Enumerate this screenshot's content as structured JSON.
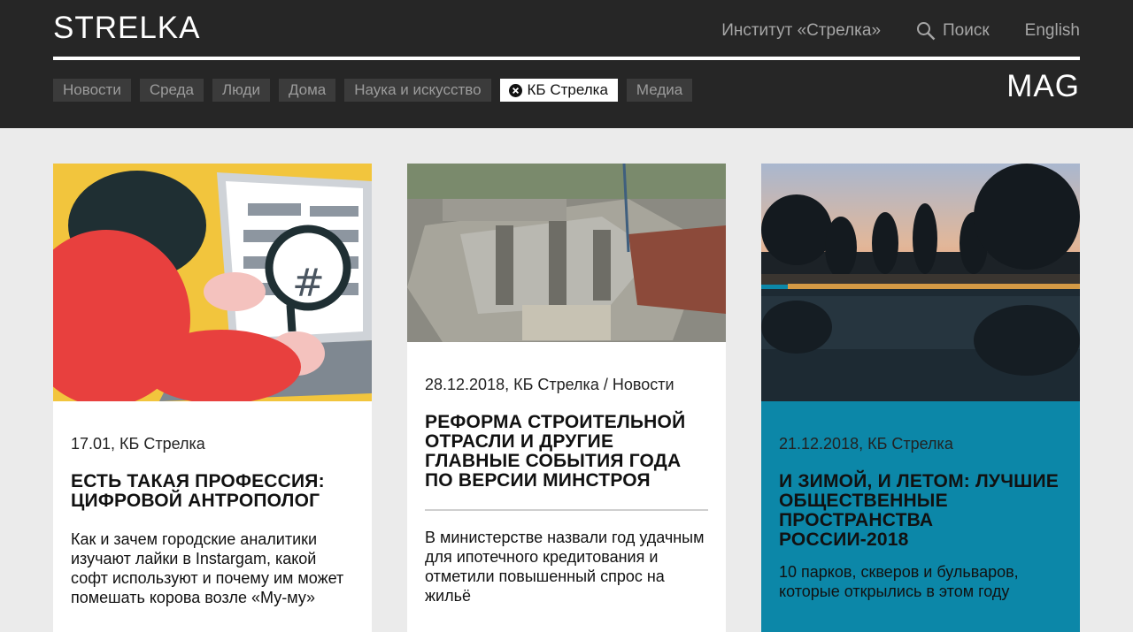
{
  "header": {
    "logo": "STRELKA",
    "links": {
      "institute": "Институт «Стрелка»",
      "search": "Поиск",
      "language": "English"
    },
    "mag": "MAG"
  },
  "tags": [
    {
      "label": "Новости",
      "active": false
    },
    {
      "label": "Среда",
      "active": false
    },
    {
      "label": "Люди",
      "active": false
    },
    {
      "label": "Дома",
      "active": false
    },
    {
      "label": "Наука и искусство",
      "active": false
    },
    {
      "label": "КБ Стрелка",
      "active": true
    },
    {
      "label": "Медиа",
      "active": false
    }
  ],
  "cards": [
    {
      "meta": "17.01, КБ Стрелка",
      "title": "Есть такая профессия: цифровой антрополог",
      "description": "Как и зачем городские аналитики изучают лайки в Instargam, какой софт используют и почему им может помешать корова возле «Му-му»",
      "image_alt": "illustration-analyst-magnifier"
    },
    {
      "meta": "28.12.2018, КБ Стрелка / Новости",
      "title": "Реформа строительной отрасли и другие главные события года по версии Минстроя",
      "description": "В министерстве назвали год удачным для ипотечного кредитования и отметили повышенный спрос на жильё",
      "image_alt": "construction-site-photo"
    },
    {
      "meta": "21.12.2018, КБ Стрелка",
      "title": "И зимой, и летом: лучшие общественные пространства России-2018",
      "description": "10 парков, скверов и бульваров, которые открылись в этом году",
      "image_alt": "park-pond-dusk-photo"
    }
  ],
  "colors": {
    "header_bg": "#262626",
    "page_bg": "#ebebeb",
    "teal_card": "#0c87a8",
    "tag_bg": "#3b3b3b"
  }
}
